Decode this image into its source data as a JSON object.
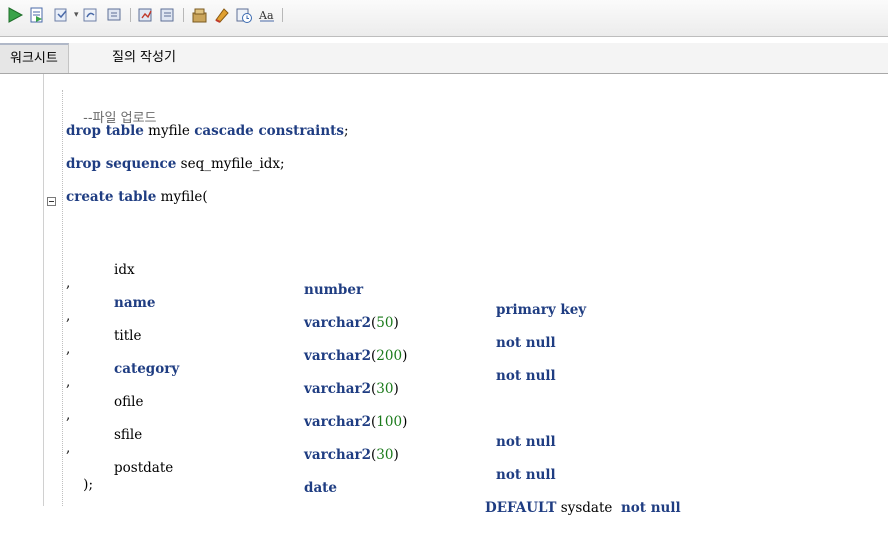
{
  "toolbar": {
    "buttons": [
      {
        "icon": "run-statement-icon"
      },
      {
        "icon": "run-script-icon"
      },
      {
        "icon": "commit-icon"
      },
      {
        "icon": "rollback-icon"
      },
      {
        "icon": "cancel-icon"
      },
      {
        "icon": "autotrace-icon"
      },
      {
        "icon": "explain-plan-icon"
      },
      {
        "icon": "sql-tuning-icon"
      },
      {
        "icon": "clear-icon"
      },
      {
        "icon": "history-icon"
      },
      {
        "icon": "format-icon"
      }
    ],
    "dropdown_glyph": "▾"
  },
  "tabs": [
    {
      "label": "워크시트"
    },
    {
      "label": "질의 작성기"
    }
  ],
  "editor": {
    "fold_glyph": "⊟",
    "lines": {
      "comment": "--파일 업로드",
      "drop_table": {
        "kw1": "drop table",
        "name": "myfile",
        "kw2": "cascade constraints",
        "end": ";"
      },
      "drop_seq": {
        "kw": "drop sequence",
        "name": "seq_myfile_idx",
        "end": ";"
      },
      "create": {
        "kw": "create table",
        "name": "myfile",
        "paren": "("
      },
      "columns": [
        {
          "lead": "",
          "name": "idx",
          "type": "number",
          "size": "",
          "constraint": "primary key"
        },
        {
          "lead": ",",
          "name": "name",
          "type": "varchar2",
          "size": "50",
          "constraint": "not null"
        },
        {
          "lead": ",",
          "name": "title",
          "type": "varchar2",
          "size": "200",
          "constraint": "not null"
        },
        {
          "lead": ",",
          "name": "category",
          "type": "varchar2",
          "size": "30",
          "constraint": ""
        },
        {
          "lead": ",",
          "name": "ofile",
          "type": "varchar2",
          "size": "100",
          "constraint": "not null"
        },
        {
          "lead": ",",
          "name": "sfile",
          "type": "varchar2",
          "size": "30",
          "constraint": "not null"
        },
        {
          "lead": ",",
          "name": "postdate",
          "type": "date",
          "size": "",
          "default_kw": "DEFAULT",
          "default_val": "sysdate",
          "constraint": "not null"
        }
      ],
      "close": ");"
    }
  }
}
